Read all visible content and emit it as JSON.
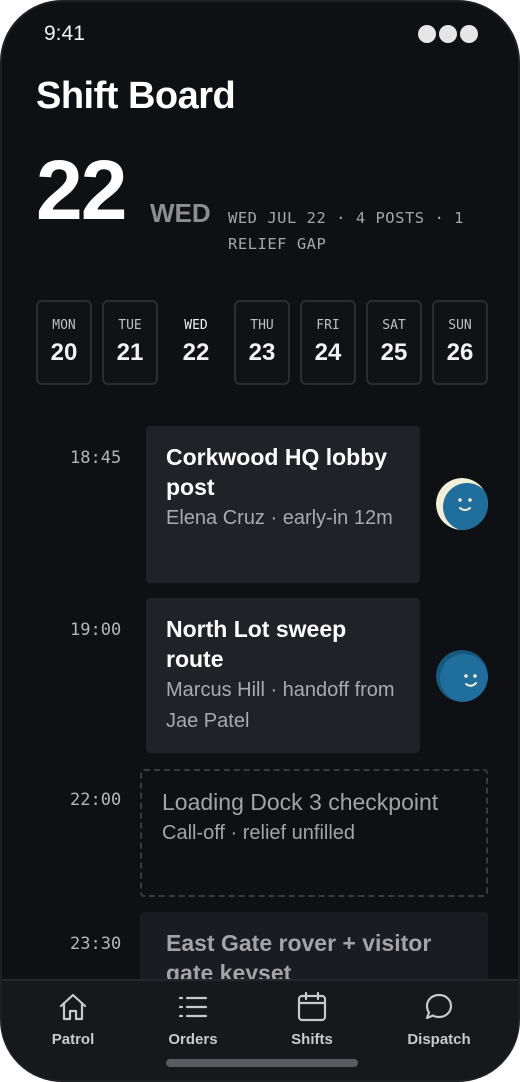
{
  "status": {
    "time": "9:41"
  },
  "app": {
    "title": "Shift Board"
  },
  "date": {
    "day": "22",
    "dow": "WED",
    "summary": "WED JUL 22 · 4 POSTS · 1 RELIEF GAP"
  },
  "week": [
    {
      "dow": "MON",
      "num": "20",
      "selected": false
    },
    {
      "dow": "TUE",
      "num": "21",
      "selected": false
    },
    {
      "dow": "WED",
      "num": "22",
      "selected": true
    },
    {
      "dow": "THU",
      "num": "23",
      "selected": false
    },
    {
      "dow": "FRI",
      "num": "24",
      "selected": false
    },
    {
      "dow": "SAT",
      "num": "25",
      "selected": false
    },
    {
      "dow": "SUN",
      "num": "26",
      "selected": false
    }
  ],
  "shifts": [
    {
      "time": "18:45",
      "title": "Corkwood HQ lobby post",
      "sub": "Elena Cruz · early-in 12m",
      "style": "filled"
    },
    {
      "time": "19:00",
      "title": "North Lot sweep route",
      "sub": "Marcus Hill · handoff from Jae Patel",
      "style": "filled"
    },
    {
      "time": "22:00",
      "title": "Loading Dock 3 checkpoint",
      "sub": "Call-off · relief unfilled",
      "style": "dashed"
    },
    {
      "time": "23:30",
      "title": "East Gate rover + visitor gate keyset",
      "sub": "",
      "style": "muted"
    }
  ],
  "tabs": [
    {
      "label": "Patrol",
      "icon": "home-icon"
    },
    {
      "label": "Orders",
      "icon": "list-icon"
    },
    {
      "label": "Shifts",
      "icon": "calendar-icon"
    },
    {
      "label": "Dispatch",
      "icon": "chat-bubble-icon"
    }
  ],
  "colors": {
    "background": "#0f1013",
    "card": "#212228",
    "avatar_blue": "#1f6e9c",
    "avatar_cream": "#f2efd6"
  }
}
